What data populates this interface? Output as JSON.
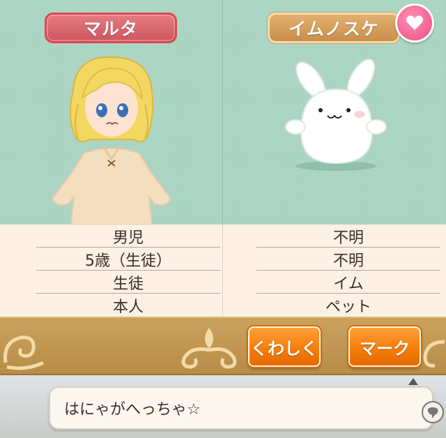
{
  "characters": [
    {
      "name": "マルタ",
      "details": [
        "男児",
        "5歳（生徒）",
        "生徒",
        "本人"
      ]
    },
    {
      "name": "イムノスケ",
      "details": [
        "不明",
        "不明",
        "イム",
        "ペット"
      ]
    }
  ],
  "favorite_icon": "heart-icon",
  "buttons": {
    "detail_label": "くわしく",
    "mark_label": "マーク"
  },
  "message": {
    "text": "はにゃがへっちゃ☆"
  },
  "colors": {
    "panel_bg": "#a8d3c1",
    "name_tag_red": "#d95c66",
    "name_tag_orange": "#d19c55",
    "heart": "#f0588d",
    "button_orange": "#f57d0a"
  }
}
